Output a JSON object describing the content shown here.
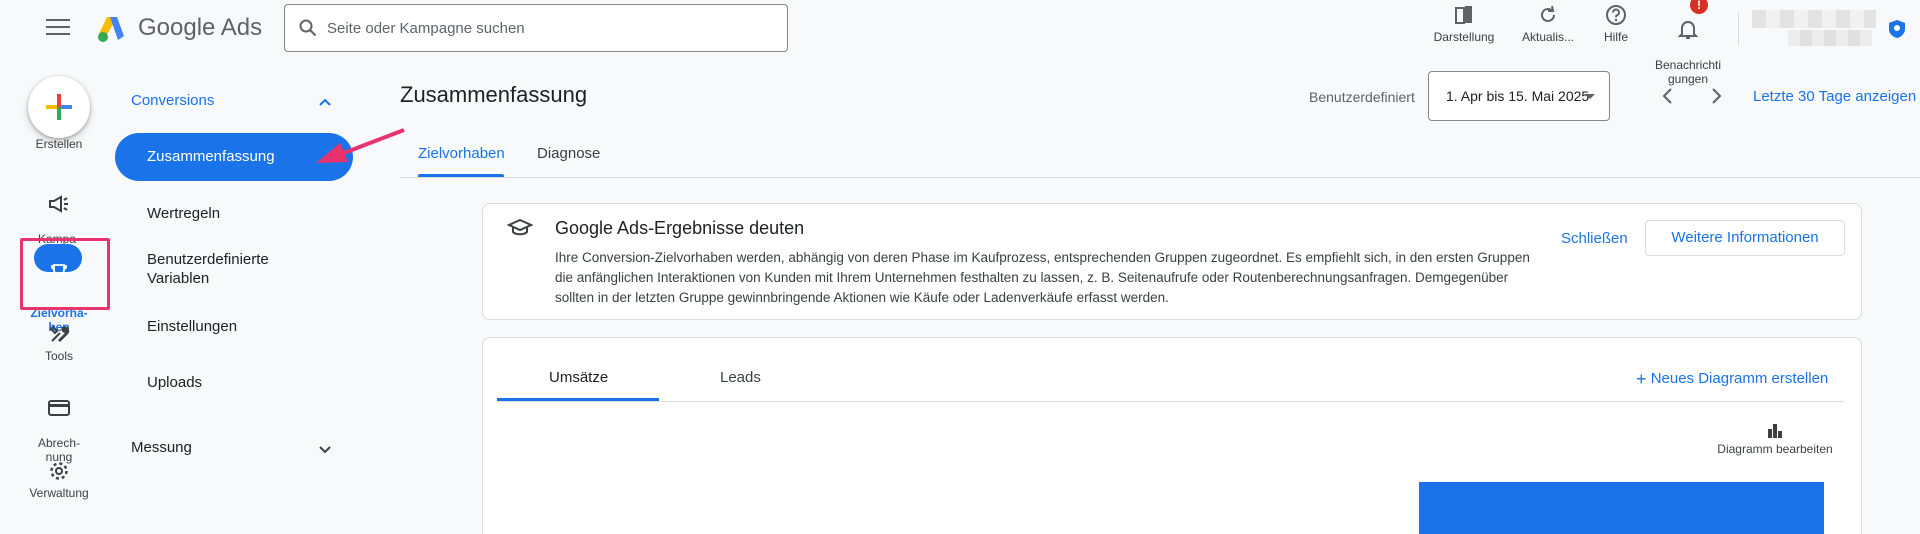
{
  "header": {
    "app_name": "Google Ads",
    "search_placeholder": "Seite oder Kampagne suchen",
    "tools": [
      {
        "label": "Darstellung",
        "icon": "appearance-icon"
      },
      {
        "label": "Aktualis...",
        "icon": "refresh-icon"
      },
      {
        "label": "Hilfe",
        "icon": "help-icon"
      },
      {
        "label": "Benachrichti\ngungen",
        "icon": "bell-icon"
      }
    ],
    "notification_badge": "!"
  },
  "rail": {
    "create_label": "Erstellen",
    "items": [
      {
        "label": "Kampa-\ngnen",
        "icon": "megaphone-icon"
      },
      {
        "label": "Zielvorha-\nben",
        "icon": "trophy-icon"
      },
      {
        "label": "Tools",
        "icon": "tools-icon"
      },
      {
        "label": "Abrech-\nnung",
        "icon": "credit-card-icon"
      },
      {
        "label": "Verwaltung",
        "icon": "gear-icon"
      }
    ]
  },
  "subnav": {
    "group_conversions": "Conversions",
    "items": [
      "Zusammenfassung",
      "Wertregeln",
      "Benutzerdefinierte\nVariablen",
      "Einstellungen",
      "Uploads"
    ],
    "group_measurement": "Messung"
  },
  "main": {
    "title": "Zusammenfassung",
    "date_label": "Benutzerdefiniert",
    "date_range": "1. Apr bis 15. Mai 2025",
    "last_30_days": "Letzte 30 Tage anzeigen",
    "tabs": [
      "Zielvorhaben",
      "Diagnose"
    ],
    "info_card": {
      "title": "Google Ads-Ergebnisse deuten",
      "body": "Ihre Conversion-Zielvorhaben werden, abhängig von deren Phase im Kaufprozess, entsprechenden Gruppen zugeordnet. Es empfiehlt sich, in den ersten Gruppen die anfänglichen Interaktionen von Kunden mit Ihrem Unternehmen festhalten zu lassen, z. B. Seitenaufrufe oder Routenberechnungsanfragen. Demgegenüber sollten in der letzten Gruppe gewinnbringende Aktionen wie Käufe oder Ladenverkäufe erfasst werden.",
      "close": "Schließen",
      "more": "Weitere Informationen"
    },
    "chart_card": {
      "tabs": [
        "Umsätze",
        "Leads"
      ],
      "new_chart": "Neues Diagramm erstellen",
      "edit_chart": "Diagramm bearbeiten"
    }
  },
  "colors": {
    "accent": "#1a73e8",
    "annotation": "#e8336f",
    "badge": "#d93025"
  }
}
